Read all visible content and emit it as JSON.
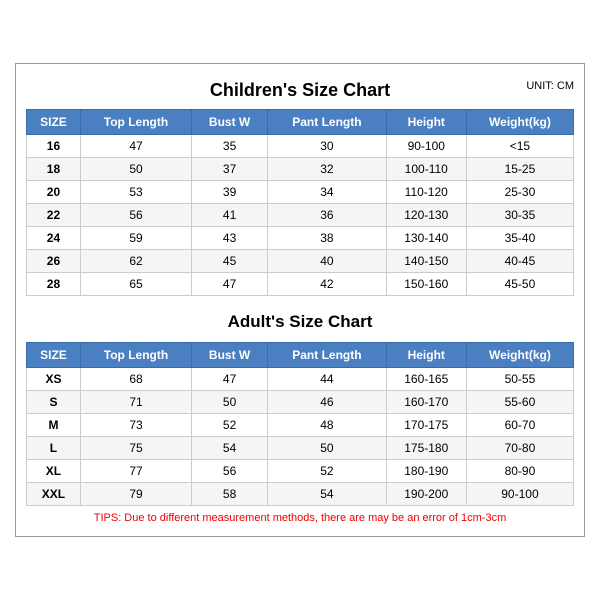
{
  "page": {
    "main_title": "Children's Size Chart",
    "unit": "UNIT: CM",
    "children_headers": [
      "SIZE",
      "Top Length",
      "Bust W",
      "Pant Length",
      "Height",
      "Weight(kg)"
    ],
    "children_rows": [
      [
        "16",
        "47",
        "35",
        "30",
        "90-100",
        "<15"
      ],
      [
        "18",
        "50",
        "37",
        "32",
        "100-110",
        "15-25"
      ],
      [
        "20",
        "53",
        "39",
        "34",
        "110-120",
        "25-30"
      ],
      [
        "22",
        "56",
        "41",
        "36",
        "120-130",
        "30-35"
      ],
      [
        "24",
        "59",
        "43",
        "38",
        "130-140",
        "35-40"
      ],
      [
        "26",
        "62",
        "45",
        "40",
        "140-150",
        "40-45"
      ],
      [
        "28",
        "65",
        "47",
        "42",
        "150-160",
        "45-50"
      ]
    ],
    "adult_title": "Adult's Size Chart",
    "adult_headers": [
      "SIZE",
      "Top Length",
      "Bust W",
      "Pant Length",
      "Height",
      "Weight(kg)"
    ],
    "adult_rows": [
      [
        "XS",
        "68",
        "47",
        "44",
        "160-165",
        "50-55"
      ],
      [
        "S",
        "71",
        "50",
        "46",
        "160-170",
        "55-60"
      ],
      [
        "M",
        "73",
        "52",
        "48",
        "170-175",
        "60-70"
      ],
      [
        "L",
        "75",
        "54",
        "50",
        "175-180",
        "70-80"
      ],
      [
        "XL",
        "77",
        "56",
        "52",
        "180-190",
        "80-90"
      ],
      [
        "XXL",
        "79",
        "58",
        "54",
        "190-200",
        "90-100"
      ]
    ],
    "tips": "TIPS: Due to different measurement methods, there are may be an error of 1cm-3cm"
  }
}
